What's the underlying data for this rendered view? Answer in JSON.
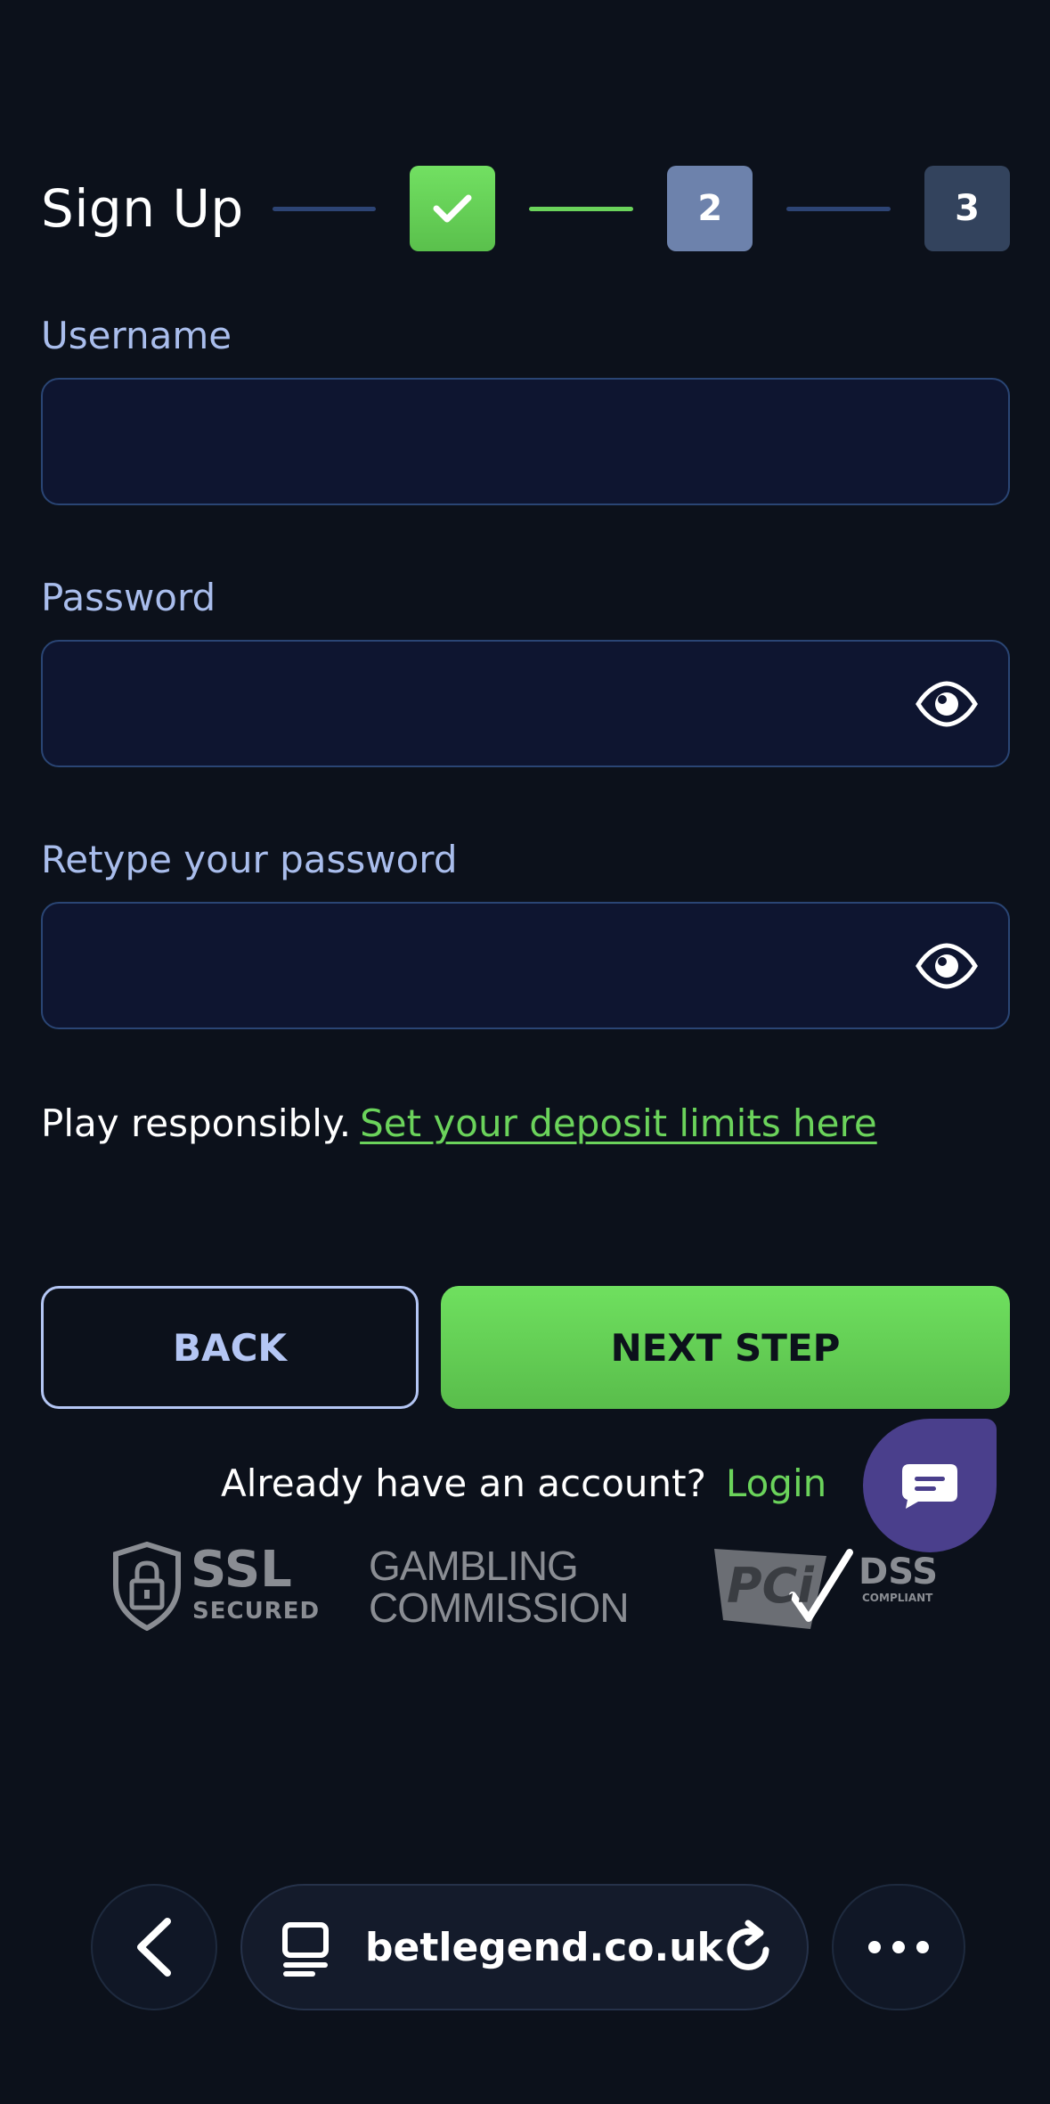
{
  "header": {
    "title": "Sign Up",
    "steps": [
      {
        "label": "",
        "state": "done"
      },
      {
        "label": "2",
        "state": "current"
      },
      {
        "label": "3",
        "state": "upcoming"
      }
    ]
  },
  "form": {
    "username_label": "Username",
    "password_label": "Password",
    "retype_label": "Retype your password"
  },
  "responsible": {
    "text": "Play responsibly.",
    "link": "Set your deposit limits here"
  },
  "buttons": {
    "back": "BACK",
    "next": "NEXT STEP"
  },
  "login": {
    "prompt": "Already have an account?",
    "link": "Login"
  },
  "badges": {
    "ssl_main": "SSL",
    "ssl_sub": "SECURED",
    "gambling_line1": "GAMBLING",
    "gambling_line2": "COMMISSION",
    "pci_main": "PCi",
    "pci_dss": "DSS",
    "pci_sub": "COMPLIANT"
  },
  "browser": {
    "url": "betlegend.co.uk"
  },
  "colors": {
    "background": "#0c111b",
    "accent_green": "#6bd35b",
    "label_blue": "#a9bdec",
    "field_bg": "#0e1530",
    "chat_purple": "#4a3f8c"
  },
  "icons": [
    "check-icon",
    "eye-icon",
    "chat-icon",
    "lock-shield-icon",
    "back-arrow-icon",
    "tabs-icon",
    "reload-icon",
    "more-icon"
  ]
}
